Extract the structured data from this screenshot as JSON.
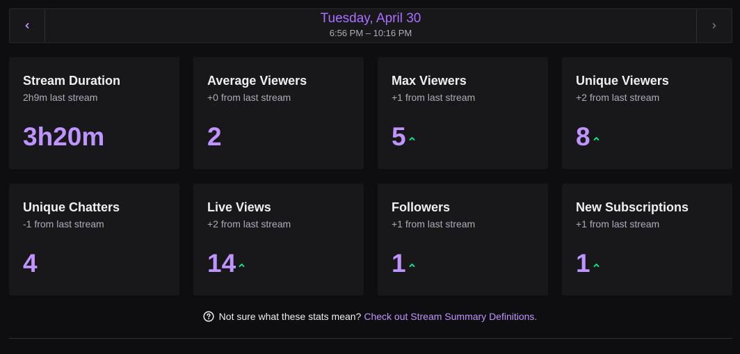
{
  "date_nav": {
    "title": "Tuesday, April 30",
    "range": "6:56 PM – 10:16 PM"
  },
  "colors": {
    "accent": "#bf94ff",
    "accent_title": "#a970ff",
    "trend_up": "#00f593",
    "background": "#0e0e10",
    "card": "#18181b"
  },
  "cards": [
    {
      "title": "Stream Duration",
      "sub": "2h9m last stream",
      "value": "3h20m",
      "trend": ""
    },
    {
      "title": "Average Viewers",
      "sub": "+0 from last stream",
      "value": "2",
      "trend": ""
    },
    {
      "title": "Max Viewers",
      "sub": "+1 from last stream",
      "value": "5",
      "trend": "up"
    },
    {
      "title": "Unique Viewers",
      "sub": "+2 from last stream",
      "value": "8",
      "trend": "up"
    },
    {
      "title": "Unique Chatters",
      "sub": "-1 from last stream",
      "value": "4",
      "trend": ""
    },
    {
      "title": "Live Views",
      "sub": "+2 from last stream",
      "value": "14",
      "trend": "up"
    },
    {
      "title": "Followers",
      "sub": "+1 from last stream",
      "value": "1",
      "trend": "up"
    },
    {
      "title": "New Subscriptions",
      "sub": "+1 from last stream",
      "value": "1",
      "trend": "up"
    }
  ],
  "help": {
    "text": "Not sure what these stats mean?",
    "link": "Check out Stream Summary Definitions."
  }
}
